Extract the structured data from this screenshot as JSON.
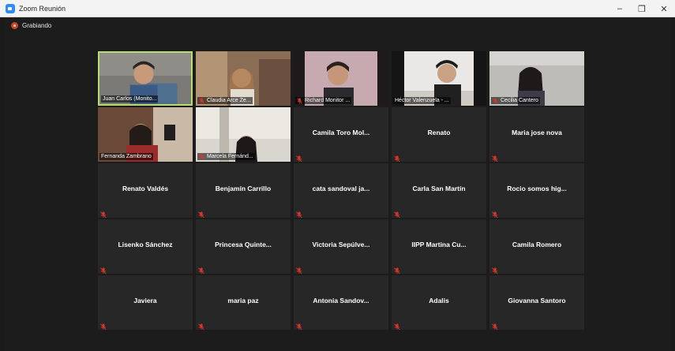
{
  "window": {
    "title": "Zoom Reunión",
    "controls": {
      "minimize": "–",
      "maximize": "❐",
      "close": "✕"
    }
  },
  "meeting": {
    "recording_label": "Grabiando",
    "tiles": [
      {
        "name": "Juan Carlos (Monito...",
        "video": true,
        "muted": false
      },
      {
        "name": "Claudia Arce Ze...",
        "video": true,
        "muted": true
      },
      {
        "name": "Richard Monitor ...",
        "video": true,
        "muted": true
      },
      {
        "name": "Héctor Valenzuela - ...",
        "video": true,
        "muted": false
      },
      {
        "name": "Cecilia Cantero",
        "video": true,
        "muted": true
      },
      {
        "name": "Fernanda Zambrano",
        "video": true,
        "muted": false
      },
      {
        "name": "Marcela Fernánd...",
        "video": true,
        "muted": true
      },
      {
        "name": "Camila Toro Mol...",
        "video": false,
        "muted": true
      },
      {
        "name": "Renato",
        "video": false,
        "muted": true
      },
      {
        "name": "Maria jose nova",
        "video": false,
        "muted": true
      },
      {
        "name": "Renato Valdés",
        "video": false,
        "muted": true
      },
      {
        "name": "Benjamín Carrillo",
        "video": false,
        "muted": true
      },
      {
        "name": "cata sandoval ja...",
        "video": false,
        "muted": true
      },
      {
        "name": "Carla San Martín",
        "video": false,
        "muted": true
      },
      {
        "name": "Rocio somos hig...",
        "video": false,
        "muted": true
      },
      {
        "name": "Lisenko Sánchez",
        "video": false,
        "muted": true
      },
      {
        "name": "Princesa Quinte...",
        "video": false,
        "muted": true
      },
      {
        "name": "Victoria Sepúlve...",
        "video": false,
        "muted": true
      },
      {
        "name": "IIPP Martina Cu...",
        "video": false,
        "muted": true
      },
      {
        "name": "Camila Romero",
        "video": false,
        "muted": true
      },
      {
        "name": "Javiera",
        "video": false,
        "muted": true
      },
      {
        "name": "maria paz",
        "video": false,
        "muted": true
      },
      {
        "name": "Antonia Sandov...",
        "video": false,
        "muted": true
      },
      {
        "name": "Adalis",
        "video": false,
        "muted": true
      },
      {
        "name": "Giovanna Santoro",
        "video": false,
        "muted": true
      }
    ]
  },
  "colors": {
    "active_speaker_border": "#b9dc6e",
    "mute_red": "#d9352a",
    "tile_bg": "#272727",
    "meeting_bg": "#1c1c1c"
  }
}
